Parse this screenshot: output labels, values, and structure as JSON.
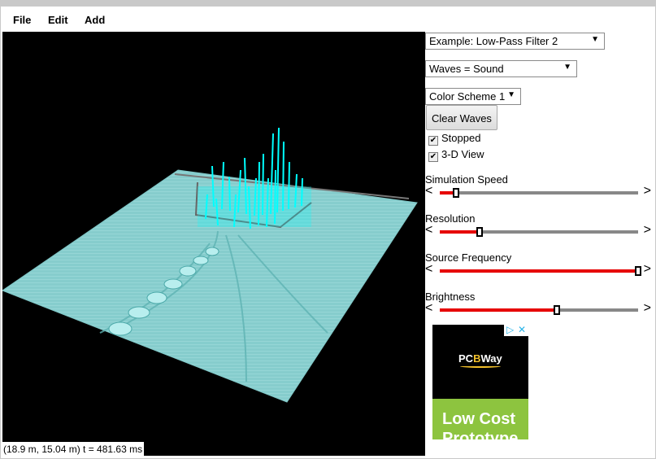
{
  "menu": {
    "file": "File",
    "edit": "Edit",
    "add": "Add"
  },
  "status": {
    "coords": "(18.9 m, 15.04 m) t = 481.63 ms"
  },
  "controls": {
    "example_select": "Example: Low-Pass Filter 2",
    "waves_select": "Waves = Sound",
    "color_select": "Color Scheme 1",
    "clear_button": "Clear Waves",
    "stopped": {
      "label": "Stopped",
      "checked": true
    },
    "view3d": {
      "label": "3-D View",
      "checked": true
    }
  },
  "sliders": [
    {
      "label": "Simulation Speed",
      "value": 0.08
    },
    {
      "label": "Resolution",
      "value": 0.2
    },
    {
      "label": "Source Frequency",
      "value": 1.0
    },
    {
      "label": "Brightness",
      "value": 0.59
    }
  ],
  "ad": {
    "brand_pre": "PC",
    "brand_accent": "B",
    "brand_post": "Way",
    "headline": "Low Cost Prototype"
  },
  "colors": {
    "wave": "#8fd6d6",
    "wave_bright": "#00ffff",
    "slider_fill": "#e60000",
    "ad_green": "#8dc43f"
  },
  "icons": {
    "left": "chevron-left-icon",
    "right": "chevron-right-icon",
    "dropdown": "dropdown-arrow-icon",
    "check": "checkmark-icon"
  }
}
